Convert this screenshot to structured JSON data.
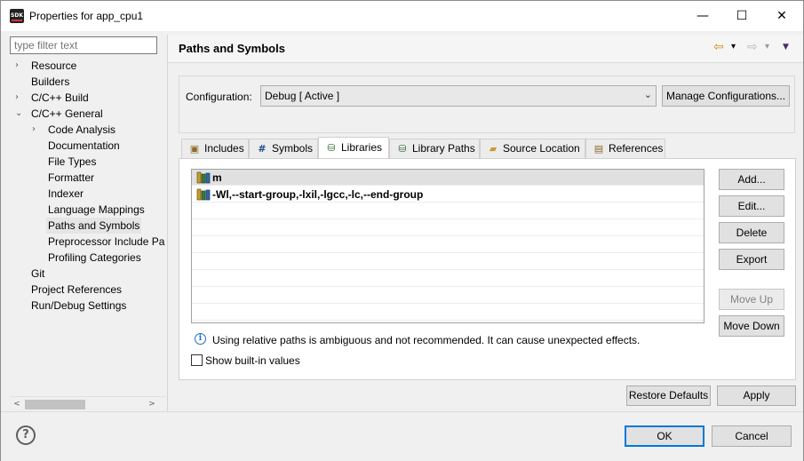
{
  "window": {
    "app_icon_text": "SDK",
    "title": "Properties for app_cpu1",
    "minimize_glyph": "—",
    "maximize_glyph": "☐",
    "close_glyph": "✕"
  },
  "filter": {
    "placeholder": "type filter text"
  },
  "tree": {
    "items": [
      {
        "label": "Resource",
        "level": 0,
        "twistie": "collapsed"
      },
      {
        "label": "Builders",
        "level": 0,
        "twistie": "none"
      },
      {
        "label": "C/C++ Build",
        "level": 0,
        "twistie": "collapsed"
      },
      {
        "label": "C/C++ General",
        "level": 0,
        "twistie": "expanded"
      },
      {
        "label": "Code Analysis",
        "level": 1,
        "twistie": "collapsed"
      },
      {
        "label": "Documentation",
        "level": 1,
        "twistie": "none"
      },
      {
        "label": "File Types",
        "level": 1,
        "twistie": "none"
      },
      {
        "label": "Formatter",
        "level": 1,
        "twistie": "none"
      },
      {
        "label": "Indexer",
        "level": 1,
        "twistie": "none"
      },
      {
        "label": "Language Mappings",
        "level": 1,
        "twistie": "none"
      },
      {
        "label": "Paths and Symbols",
        "level": 1,
        "twistie": "none",
        "selected": true
      },
      {
        "label": "Preprocessor Include Pa",
        "level": 1,
        "twistie": "none"
      },
      {
        "label": "Profiling Categories",
        "level": 1,
        "twistie": "none"
      },
      {
        "label": "Git",
        "level": 0,
        "twistie": "none"
      },
      {
        "label": "Project References",
        "level": 0,
        "twistie": "none"
      },
      {
        "label": "Run/Debug Settings",
        "level": 0,
        "twistie": "none"
      }
    ],
    "scroll_left_glyph": "<",
    "scroll_right_glyph": ">"
  },
  "page": {
    "title": "Paths and Symbols",
    "nav": {
      "back_glyph": "⇦",
      "forward_glyph": "⇨",
      "dropdown_glyph": "▾",
      "menu_glyph": "▼"
    }
  },
  "configuration": {
    "label": "Configuration:",
    "value": "Debug  [ Active ]",
    "manage_button": "Manage Configurations..."
  },
  "tabs": [
    {
      "label": "Includes",
      "icon": "includes-icon"
    },
    {
      "label": "Symbols",
      "icon": "hash-icon"
    },
    {
      "label": "Libraries",
      "icon": "library-icon",
      "active": true
    },
    {
      "label": "Library Paths",
      "icon": "library-paths-icon"
    },
    {
      "label": "Source Location",
      "icon": "folder-icon"
    },
    {
      "label": "References",
      "icon": "references-icon"
    }
  ],
  "libraries": {
    "rows": [
      {
        "label": "m",
        "selected": true
      },
      {
        "label": "-Wl,--start-group,-lxil,-lgcc,-lc,--end-group"
      }
    ],
    "buttons": {
      "add": "Add...",
      "edit": "Edit...",
      "delete": "Delete",
      "export": "Export",
      "move_up": "Move Up",
      "move_down": "Move Down"
    },
    "info_glyph": "i",
    "info_text": "Using relative paths is ambiguous and not recommended. It can cause unexpected effects.",
    "show_builtin_label": "Show built-in values",
    "show_builtin_checked": false
  },
  "footer": {
    "restore_defaults": "Restore Defaults",
    "apply": "Apply",
    "ok": "OK",
    "cancel": "Cancel",
    "help_glyph": "?"
  },
  "colors": {
    "accent": "#0078d7",
    "selection": "#e5e5e5",
    "info": "#1f6fbf"
  }
}
